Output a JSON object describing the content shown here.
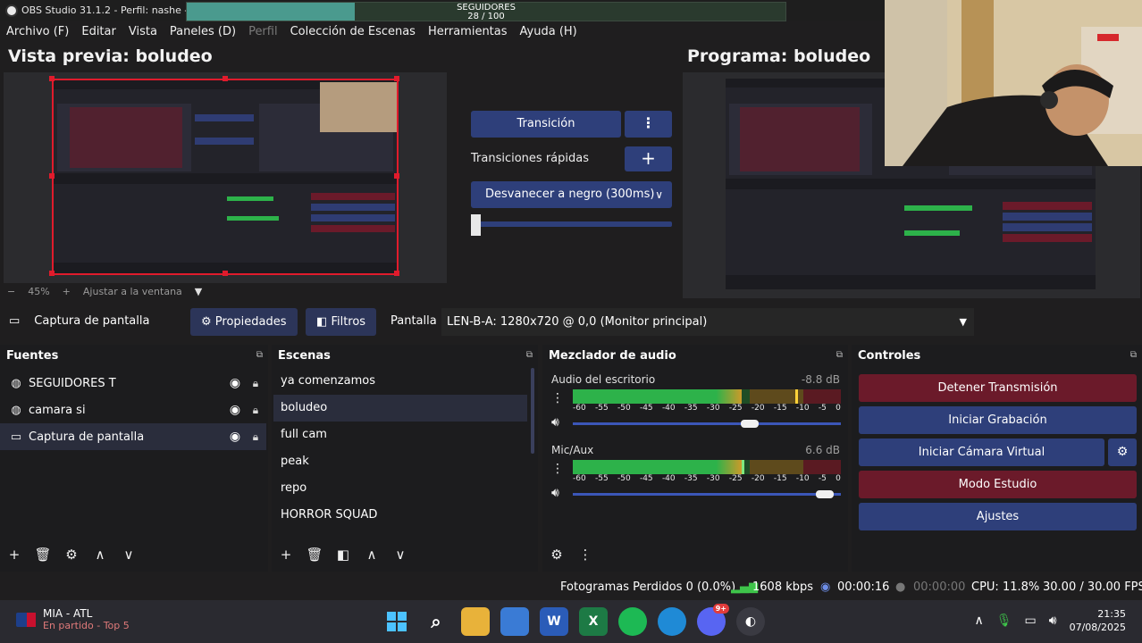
{
  "window": {
    "title": "OBS Studio 31.1.2 - Perfil: nashe - E",
    "followers": {
      "label": "SEGUIDORES",
      "count": "28 / 100",
      "progress": 0.28
    }
  },
  "menu": {
    "items": [
      {
        "label": "Archivo (F)",
        "disabled": false
      },
      {
        "label": "Editar",
        "disabled": false
      },
      {
        "label": "Vista",
        "disabled": false
      },
      {
        "label": "Paneles (D)",
        "disabled": false
      },
      {
        "label": "Perfil",
        "disabled": true
      },
      {
        "label": "Colección de Escenas",
        "disabled": false
      },
      {
        "label": "Herramientas",
        "disabled": false
      },
      {
        "label": "Ayuda (H)",
        "disabled": false
      }
    ]
  },
  "preview": {
    "title": "Vista previa: boludeo",
    "zoom": "45%",
    "fit_label": "Ajustar a la ventana"
  },
  "program": {
    "title": "Programa: boludeo"
  },
  "transition": {
    "button": "Transición",
    "quick_label": "Transiciones rápidas",
    "fade": "Desvanecer a negro (300ms)"
  },
  "source_toolbar": {
    "source_name": "Captura de pantalla",
    "properties": "Propiedades",
    "filters": "Filtros",
    "screen_label": "Pantalla",
    "monitor": "LEN-B-A: 1280x720 @ 0,0 (Monitor principal)"
  },
  "sources": {
    "title": "Fuentes",
    "items": [
      {
        "label": "SEGUIDORES T",
        "icon": "globe-icon",
        "selected": false
      },
      {
        "label": "camara si",
        "icon": "globe-icon",
        "selected": false
      },
      {
        "label": "Captura de pantalla",
        "icon": "monitor-icon",
        "selected": true
      }
    ]
  },
  "scenes": {
    "title": "Escenas",
    "items": [
      {
        "label": "ya comenzamos",
        "selected": false
      },
      {
        "label": "boludeo",
        "selected": true
      },
      {
        "label": "full cam",
        "selected": false
      },
      {
        "label": "peak",
        "selected": false
      },
      {
        "label": "repo",
        "selected": false
      },
      {
        "label": "HORROR SQUAD",
        "selected": false
      }
    ]
  },
  "mixer": {
    "title": "Mezclador de audio",
    "channels": [
      {
        "name": "Audio del escritorio",
        "db": "-8.8 dB",
        "level": 0.63,
        "peak": 0.83,
        "volume": 0.67
      },
      {
        "name": "Mic/Aux",
        "db": "6.6 dB",
        "level": 0.63,
        "peak": 0.63,
        "volume": 0.97
      }
    ],
    "ticks": [
      "-60",
      "-55",
      "-50",
      "-45",
      "-40",
      "-35",
      "-30",
      "-25",
      "-20",
      "-15",
      "-10",
      "-5",
      "0"
    ]
  },
  "controls": {
    "title": "Controles",
    "stop_stream": "Detener Transmisión",
    "start_recording": "Iniciar Grabación",
    "virtual_cam": "Iniciar Cámara Virtual",
    "studio_mode": "Modo Estudio",
    "settings": "Ajustes"
  },
  "status": {
    "dropped": "Fotogramas Perdidos 0 (0.0%)",
    "bitrate": "1608 kbps",
    "stream_time": "00:00:16",
    "record_time": "00:00:00",
    "cpu": "CPU: 11.8%",
    "fps": "30.00 / 30.00 FPS"
  },
  "taskbar": {
    "widget_title": "MIA - ATL",
    "widget_sub": "En partido - Top 5",
    "time": "21:35",
    "date": "07/08/2025",
    "discord_badge": "9+"
  },
  "colors": {
    "accent_blue": "#2e3f7a",
    "accent_red": "#6b1a2a",
    "meter_green": "#2db24a"
  }
}
